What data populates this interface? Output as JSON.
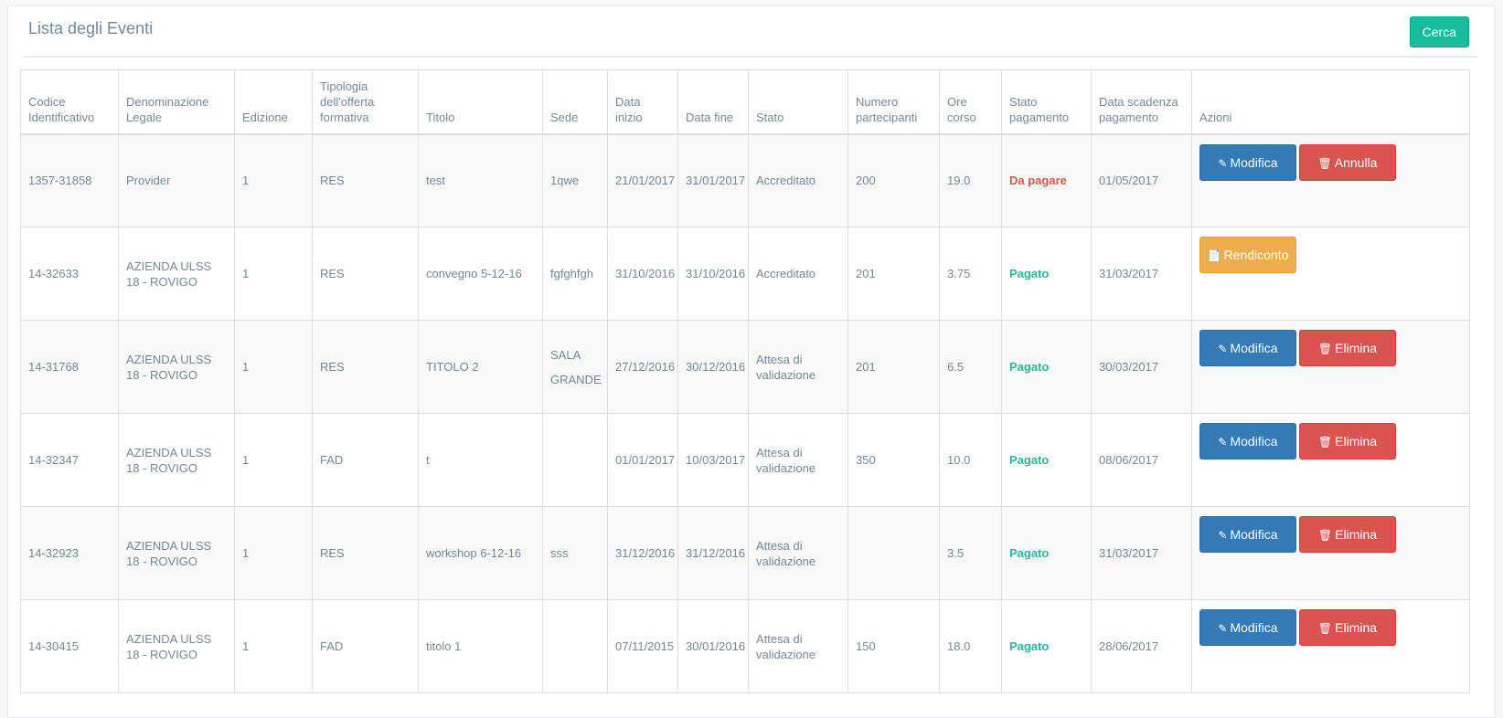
{
  "header": {
    "title": "Lista degli Eventi",
    "search_label": "Cerca"
  },
  "table": {
    "columns": [
      "Codice Identificativo",
      "Denominazione Legale",
      "Edizione",
      "Tipologia dell'offerta formativa",
      "Titolo",
      "Sede",
      "Data inizio",
      "Data fine",
      "Stato",
      "Numero partecipanti",
      "Ore corso",
      "Stato pagamento",
      "Data scadenza pagamento",
      "Azioni"
    ],
    "rows": [
      {
        "codice": "1357-31858",
        "denominazione": "Provider",
        "edizione": "1",
        "tipologia": "RES",
        "titolo": "test",
        "sede": "1qwe",
        "data_inizio": "21/01/2017",
        "data_fine": "31/01/2017",
        "stato": "Accreditato",
        "partecipanti": "200",
        "ore": "19.0",
        "pagamento": "Da pagare",
        "scadenza": "01/05/2017",
        "azioni": [
          "Modifica",
          "Annulla"
        ]
      },
      {
        "codice": "14-32633",
        "denominazione": "AZIENDA ULSS 18 - ROVIGO",
        "edizione": "1",
        "tipologia": "RES",
        "titolo": "convegno 5-12-16",
        "sede": "fgfghfgh",
        "data_inizio": "31/10/2016",
        "data_fine": "31/10/2016",
        "stato": "Accreditato",
        "partecipanti": "201",
        "ore": "3.75",
        "pagamento": "Pagato",
        "scadenza": "31/03/2017",
        "azioni": [
          "Rendiconto"
        ]
      },
      {
        "codice": "14-31768",
        "denominazione": "AZIENDA ULSS 18 - ROVIGO",
        "edizione": "1",
        "tipologia": "RES",
        "titolo": "TITOLO 2",
        "sede": "SALA GRANDE",
        "data_inizio": "27/12/2016",
        "data_fine": "30/12/2016",
        "stato": "Attesa di validazione",
        "partecipanti": "201",
        "ore": "6.5",
        "pagamento": "Pagato",
        "scadenza": "30/03/2017",
        "azioni": [
          "Modifica",
          "Elimina"
        ]
      },
      {
        "codice": "14-32347",
        "denominazione": "AZIENDA ULSS 18 - ROVIGO",
        "edizione": "1",
        "tipologia": "FAD",
        "titolo": "t",
        "sede": "",
        "data_inizio": "01/01/2017",
        "data_fine": "10/03/2017",
        "stato": "Attesa di validazione",
        "partecipanti": "350",
        "ore": "10.0",
        "pagamento": "Pagato",
        "scadenza": "08/06/2017",
        "azioni": [
          "Modifica",
          "Elimina"
        ]
      },
      {
        "codice": "14-32923",
        "denominazione": "AZIENDA ULSS 18 - ROVIGO",
        "edizione": "1",
        "tipologia": "RES",
        "titolo": "workshop 6-12-16",
        "sede": "sss",
        "data_inizio": "31/12/2016",
        "data_fine": "31/12/2016",
        "stato": "Attesa di validazione",
        "partecipanti": "",
        "ore": "3.5",
        "pagamento": "Pagato",
        "scadenza": "31/03/2017",
        "azioni": [
          "Modifica",
          "Elimina"
        ]
      },
      {
        "codice": "14-30415",
        "denominazione": "AZIENDA ULSS 18 - ROVIGO",
        "edizione": "1",
        "tipologia": "FAD",
        "titolo": "titolo 1",
        "sede": "",
        "data_inizio": "07/11/2015",
        "data_fine": "30/01/2016",
        "stato": "Attesa di validazione",
        "partecipanti": "150",
        "ore": "18.0",
        "pagamento": "Pagato",
        "scadenza": "28/06/2017",
        "azioni": [
          "Modifica",
          "Elimina"
        ]
      }
    ]
  },
  "colors": {
    "success": "#1abb9c",
    "primary": "#337ab7",
    "danger": "#d9534f",
    "warning": "#f0ad4e",
    "paid": "#26b99a"
  },
  "icons": {
    "Modifica": "pencil-icon",
    "Annulla": "trash-icon",
    "Elimina": "trash-icon",
    "Rendiconto": "file-icon"
  }
}
